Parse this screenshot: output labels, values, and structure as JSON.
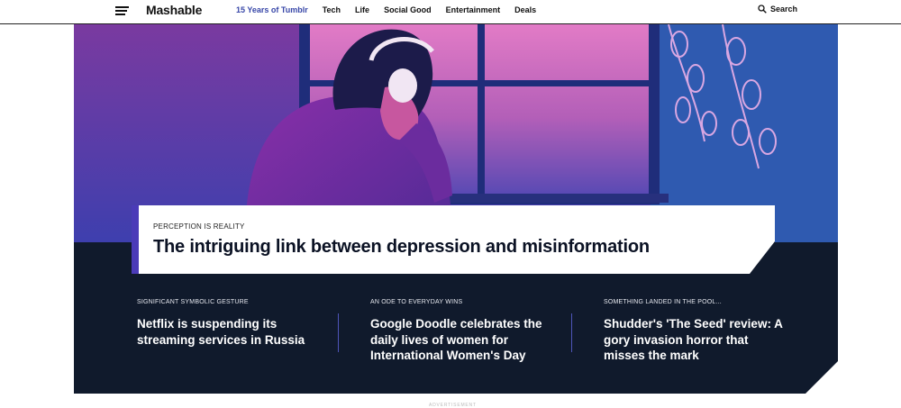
{
  "nav": {
    "menu_icon": "hamburger-menu-icon",
    "logo": "Mashable",
    "links": [
      {
        "label": "15 Years of Tumblr",
        "accent": true
      },
      {
        "label": "Tech"
      },
      {
        "label": "Life"
      },
      {
        "label": "Social Good"
      },
      {
        "label": "Entertainment"
      },
      {
        "label": "Deals"
      }
    ],
    "search_label": "Search",
    "search_icon": "search-icon",
    "accent_color": "#3847a8"
  },
  "hero": {
    "image_icon": "illustration-woman-with-headphones",
    "kicker": "PERCEPTION IS REALITY",
    "headline": "The intriguing link between depression and misinformation",
    "bg_color": "#101a2c",
    "accent_color": "#4b3bb8"
  },
  "stories": [
    {
      "kicker": "SIGNIFICANT SYMBOLIC GESTURE",
      "title": "Netflix is suspending its streaming services in Russia"
    },
    {
      "kicker": "AN ODE TO EVERYDAY WINS",
      "title": "Google Doodle celebrates the daily lives of women for International Women's Day"
    },
    {
      "kicker": "SOMETHING LANDED IN THE POOL...",
      "title": "Shudder's 'The Seed' review: A gory invasion horror that misses the mark"
    }
  ],
  "ad_label": "ADVERTISEMENT"
}
